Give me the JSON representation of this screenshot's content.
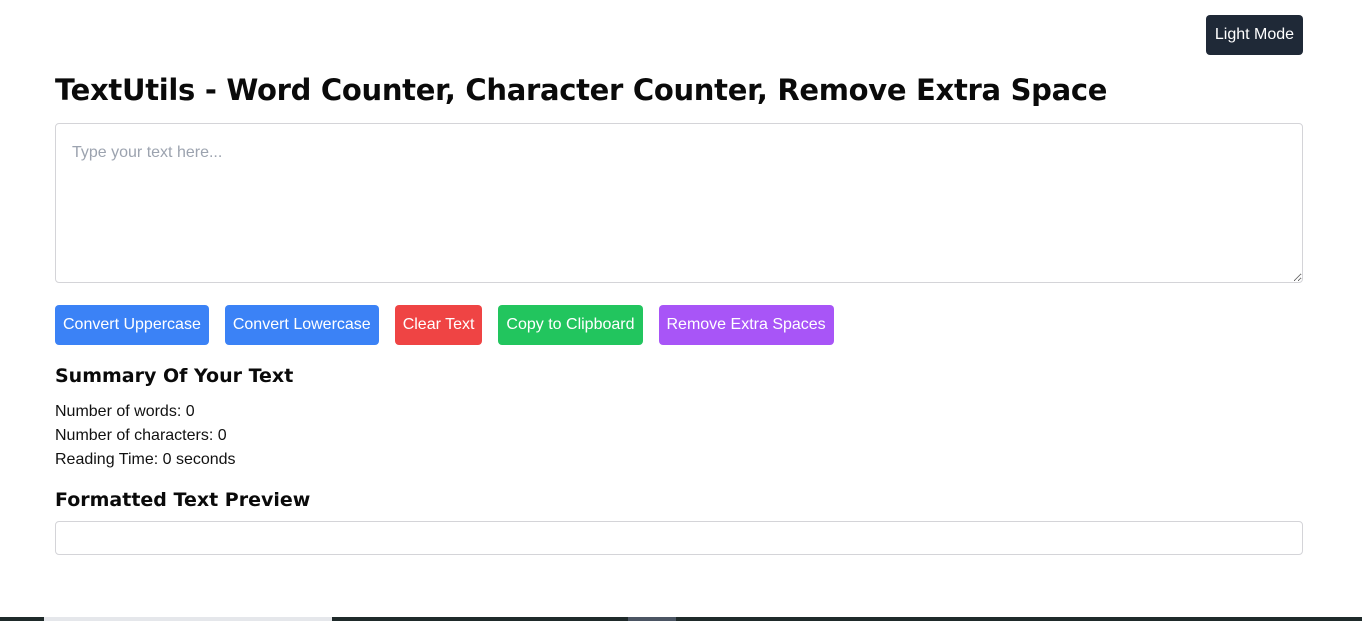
{
  "header": {
    "theme_toggle_label": "Light Mode"
  },
  "main": {
    "title": "TextUtils - Word Counter, Character Counter, Remove Extra Space",
    "textarea": {
      "placeholder": "Type your text here...",
      "value": ""
    },
    "buttons": {
      "uppercase": "Convert Uppercase",
      "lowercase": "Convert Lowercase",
      "clear": "Clear Text",
      "copy": "Copy to Clipboard",
      "remove_spaces": "Remove Extra Spaces"
    },
    "summary": {
      "heading": "Summary Of Your Text",
      "words": "Number of words: 0",
      "characters": "Number of characters: 0",
      "reading_time": "Reading Time: 0 seconds"
    },
    "preview": {
      "heading": "Formatted Text Preview",
      "content": ""
    }
  },
  "colors": {
    "toggle_bg": "#1f2937",
    "blue": "#3b82f6",
    "red": "#ef4444",
    "green": "#22c55e",
    "purple": "#a855f7"
  }
}
